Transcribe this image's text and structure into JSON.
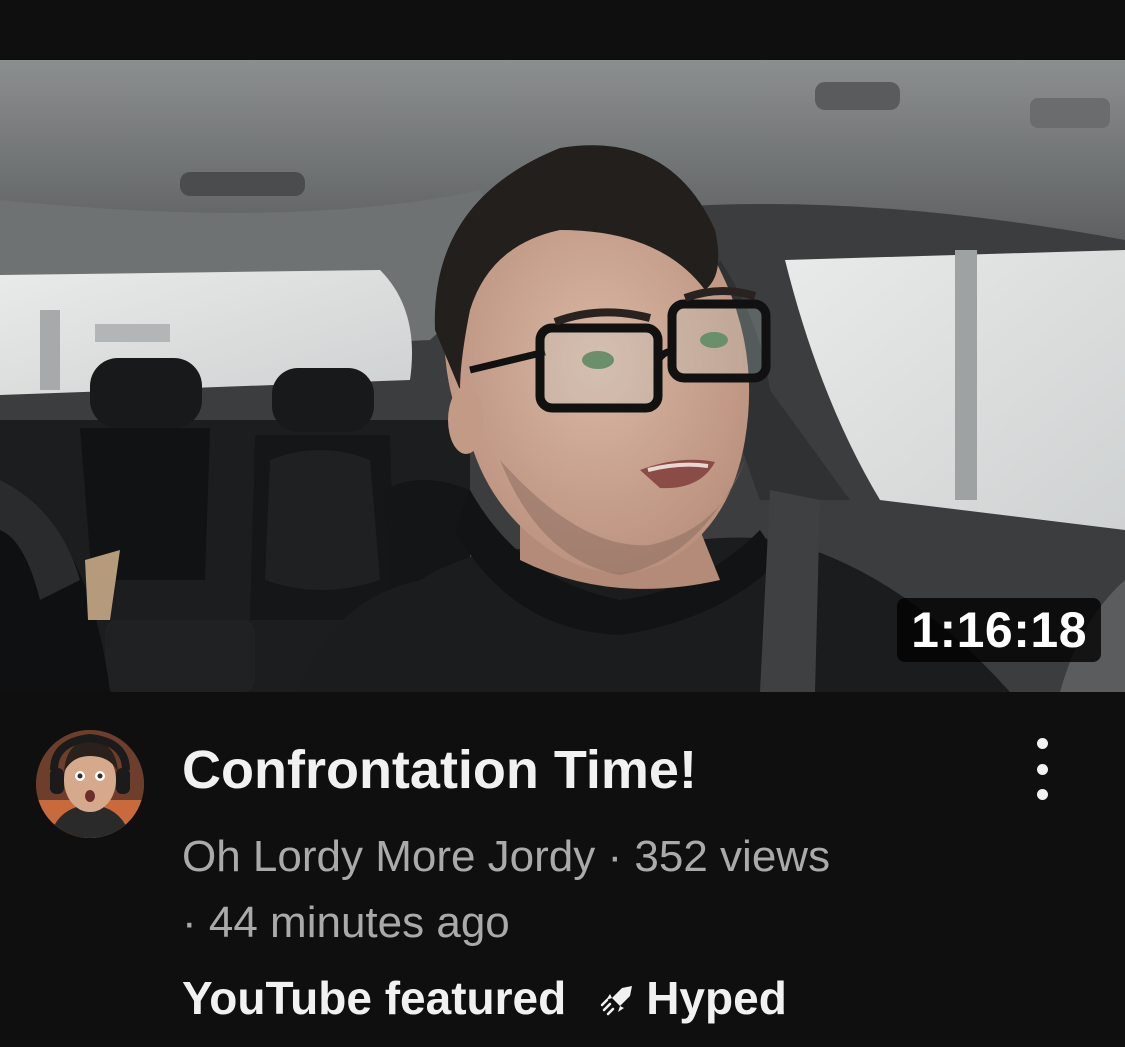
{
  "video": {
    "duration": "1:16:18",
    "title": "Confrontation Time!",
    "channel": "Oh Lordy More Jordy",
    "views": "352 views",
    "age": "44 minutes ago",
    "separator": "·",
    "badge_featured": "YouTube featured",
    "badge_hyped": "Hyped"
  },
  "icons": {
    "more": "more-vertical-icon",
    "hyped": "hyped-rocket-icon"
  },
  "colors": {
    "background": "#0f0f0f",
    "title": "#f1f1f1",
    "meta": "#aaaaaa"
  }
}
